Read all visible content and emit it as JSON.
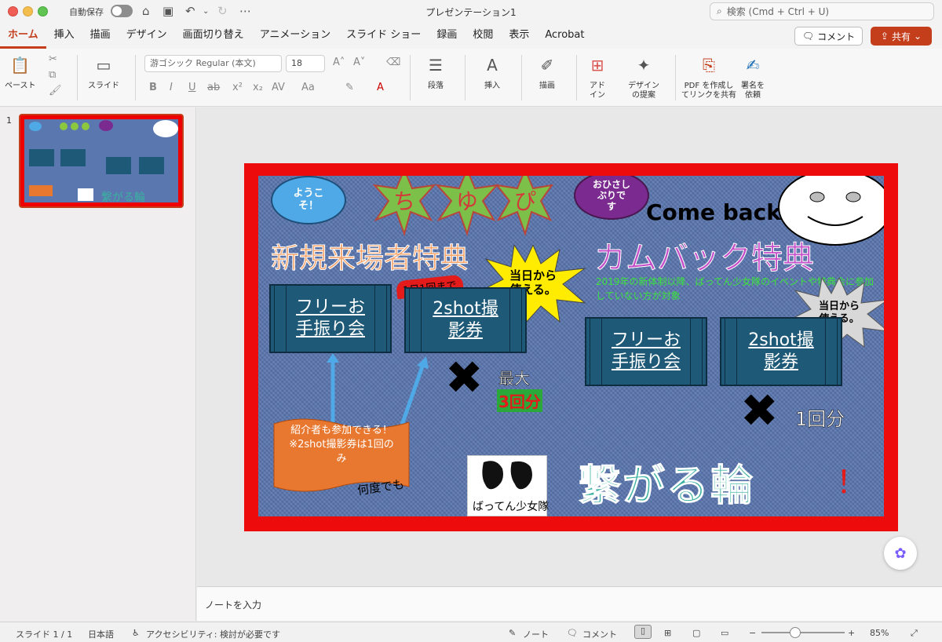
{
  "window": {
    "autosave_label": "自動保存",
    "doc_title": "プレゼンテーション1",
    "search_placeholder": "検索 (Cmd + Ctrl + U)"
  },
  "tabs": [
    "ホーム",
    "挿入",
    "描画",
    "デザイン",
    "画面切り替え",
    "アニメーション",
    "スライド ショー",
    "録画",
    "校閲",
    "表示",
    "Acrobat"
  ],
  "header_buttons": {
    "comment": "コメント",
    "share": "共有"
  },
  "ribbon": {
    "paste": "ペースト",
    "slide": "スライド",
    "font_name": "游ゴシック Regular (本文)",
    "font_size": "18",
    "paragraph": "段落",
    "insert": "挿入",
    "draw": "描画",
    "addin": "アド\nイン",
    "design_suggest": "デザイン\nの提案",
    "pdf_share": "PDF を作成し\nてリンクを共有",
    "sign": "署名を\n依頼"
  },
  "sidebar": {
    "slide_number": "1"
  },
  "notes_placeholder": "ノートを入力",
  "status": {
    "slide_pos": "スライド 1 / 1",
    "language": "日本語",
    "accessibility": "アクセシビリティ: 検討が必要です",
    "notes": "ノート",
    "comments": "コメント",
    "zoom": "85%"
  },
  "slide": {
    "bubble_welcome": "ようこ\nそ！",
    "stars": [
      "ち",
      "ゆ",
      "ぴ"
    ],
    "bubble_long_time": "おひさし\nぶりで\nす",
    "come_back": "Come back",
    "title_new": "新規来場者特典",
    "title_comeback": "カムバック特典",
    "burst_same_day_1": "当日から\n使える。",
    "burst_same_day_2": "当日から\n使える。",
    "once_ribbon": "1日1回まで",
    "box_free_1": "フリーお\n手振り会",
    "box_2shot_1": "2shot撮\n影券",
    "box_free_2": "フリーお\n手振り会",
    "box_2shot_2": "2shot撮\n影券",
    "max_label": "最大",
    "max_count": "3回分",
    "once_count": "1回分",
    "green_note": "2019年の新体制以降、ばってん少女隊のイベントや特典会に参加していない方が対象",
    "flag_text": "紹介者も参加できる！\n※2shot撮影券は1回の\nみ",
    "many_times": "何度でも",
    "logo_text": "ばってん少女隊",
    "tagline": "繋がる輪",
    "exclaim": "！"
  },
  "colors": {
    "accent": "#c43e1c",
    "slide_border": "#ee0b0b",
    "slide_bg": "#5874ad",
    "box": "#1e5a78"
  }
}
